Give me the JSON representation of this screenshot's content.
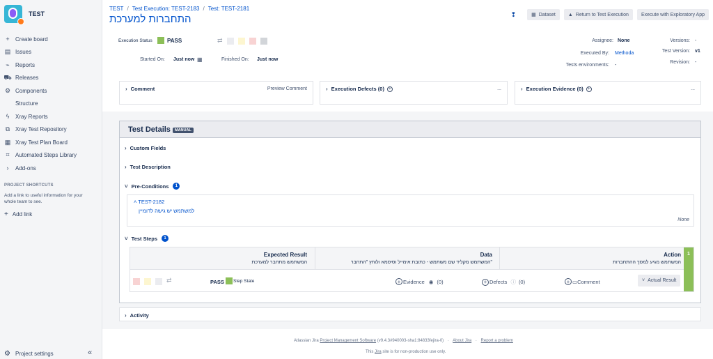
{
  "project": {
    "name": "TEST"
  },
  "sidebar": {
    "items": [
      {
        "label": "Create board",
        "icon": "plus-icon"
      },
      {
        "label": "Issues",
        "icon": "issues-icon"
      },
      {
        "label": "Reports",
        "icon": "reports-icon"
      },
      {
        "label": "Releases",
        "icon": "releases-icon"
      },
      {
        "label": "Components",
        "icon": "components-icon"
      },
      {
        "label": "Structure",
        "icon": ""
      },
      {
        "label": "Xray Reports",
        "icon": "xray-icon"
      },
      {
        "label": "Xray Test Repository",
        "icon": "repository-icon"
      },
      {
        "label": "Xray Test Plan Board",
        "icon": "board-icon"
      },
      {
        "label": "Automated Steps Library",
        "icon": "library-icon"
      },
      {
        "label": "Add-ons",
        "icon": "chevron-right-icon"
      }
    ],
    "shortcuts_title": "PROJECT SHORTCUTS",
    "shortcuts_text": "Add a link to useful information for your whole team to see.",
    "add_link": "Add link",
    "project_settings": "Project settings"
  },
  "breadcrumb": {
    "root": "TEST",
    "execution": "Test Execution: TEST-2183",
    "test": "Test: TEST-2181"
  },
  "page_title": "התחברות למערכת",
  "header_buttons": {
    "dataset": "Dataset",
    "return": "Return to Test Execution",
    "exploratory": "Execute with Exploratory App"
  },
  "execution": {
    "status_label": "Execution Status",
    "status": "PASS",
    "started_label": "Started On:",
    "started_value": "Just now",
    "finished_label": "Finished On:",
    "finished_value": "Just now",
    "assignee_label": "Assignee:",
    "assignee_value": "None",
    "executed_by_label": "Executed By:",
    "executed_by_value": "Methoda",
    "environments_label": "Tests environments:",
    "environments_value": "-",
    "versions_label": "Versions:",
    "versions_value": "-",
    "test_version_label": "Test Version:",
    "test_version_value": "v1",
    "revision_label": "Revision:",
    "revision_value": "-"
  },
  "panels": {
    "comment": "Comment",
    "preview_comment": "Preview Comment",
    "defects": "Execution Defects (0)",
    "evidence": "Execution Evidence (0)",
    "more": "..."
  },
  "test_details": {
    "title": "Test Details",
    "badge": "MANUAL",
    "custom_fields": "Custom Fields",
    "test_description": "Test Description",
    "preconditions": "Pre-Conditions",
    "preconditions_count": "1",
    "precondition_link": "TEST-2182",
    "precondition_text": "למשתמש יש גישה לדומיין",
    "precondition_none": "None",
    "test_steps": "Test Steps",
    "test_steps_count": "1",
    "columns": {
      "expected": "Expected Result",
      "data": "Data",
      "action": "Action"
    },
    "step": {
      "number": "1",
      "expected": "המשתמש מתחבר למערכת",
      "data": "המשתמש מקליד שם משתמש - כתובת אימייל וסיסמא ולוחץ \"התחבר\"",
      "action": "המשתמש מגיע למסך ההתחברות",
      "status": "PASS",
      "step_state": "Step State",
      "evidence": "Evidence",
      "evidence_count": "(0)",
      "defects": "Defects",
      "defects_count": "(0)",
      "comment": "Comment",
      "actual_result": "Actual Result"
    },
    "activity": "Activity"
  },
  "footer": {
    "prefix": "Atlassian Jira",
    "pms": "Project Management Software",
    "version": "(v9.4.3#940003-sha1:84833fejira-0)",
    "about": "About Jira",
    "report": "Report a problem",
    "line2_pre": "This",
    "line2_link": "Jira",
    "line2_post": "site is for non-production use only."
  },
  "colors": {
    "pass": "#8cbf58",
    "link": "#0052cc"
  }
}
